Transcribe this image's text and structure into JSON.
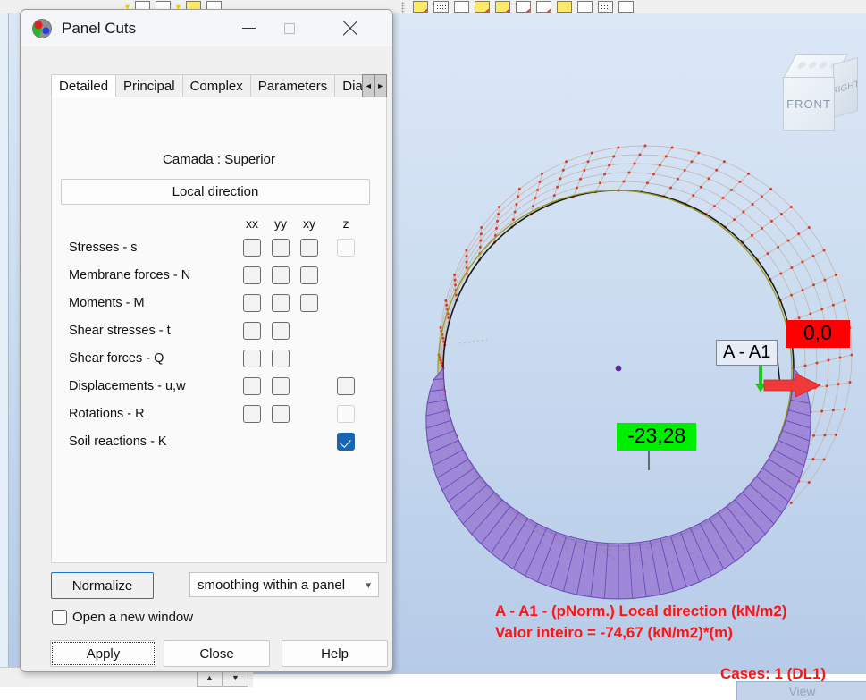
{
  "dialog": {
    "title": "Panel Cuts",
    "window_buttons": {
      "minimize": "minimize-icon",
      "maximize": "maximize-icon",
      "close": "close-icon"
    },
    "tabs": [
      {
        "label": "Detailed",
        "active": true
      },
      {
        "label": "Principal",
        "active": false
      },
      {
        "label": "Complex",
        "active": false
      },
      {
        "label": "Parameters",
        "active": false
      },
      {
        "label": "Dia",
        "active": false
      }
    ],
    "tab_nav": {
      "prev": "◄",
      "next": "►"
    },
    "layer_label": "Camada : Superior",
    "direction_button": "Local direction",
    "grid": {
      "columns": [
        "xx",
        "yy",
        "xy",
        "z"
      ],
      "rows": [
        {
          "label": "Stresses - s",
          "xx": "unchecked",
          "yy": "unchecked",
          "xy": "unchecked",
          "z": "disabled"
        },
        {
          "label": "Membrane forces - N",
          "xx": "unchecked",
          "yy": "unchecked",
          "xy": "unchecked",
          "z": "none"
        },
        {
          "label": "Moments - M",
          "xx": "unchecked",
          "yy": "unchecked",
          "xy": "unchecked",
          "z": "none"
        },
        {
          "label": "Shear stresses - t",
          "xx": "unchecked",
          "yy": "unchecked",
          "xy": "none",
          "z": "none"
        },
        {
          "label": "Shear forces - Q",
          "xx": "unchecked",
          "yy": "unchecked",
          "xy": "none",
          "z": "none"
        },
        {
          "label": "Displacements - u,w",
          "xx": "unchecked",
          "yy": "unchecked",
          "xy": "none",
          "z": "unchecked"
        },
        {
          "label": "Rotations - R",
          "xx": "unchecked",
          "yy": "unchecked",
          "xy": "none",
          "z": "disabled"
        },
        {
          "label": "Soil reactions - K",
          "xx": "none",
          "yy": "none",
          "xy": "none",
          "z": "checked"
        }
      ]
    },
    "normalize_button": "Normalize",
    "smoothing_select": {
      "value": "smoothing within a panel",
      "chevron": "chevron-down-icon"
    },
    "open_new_window": {
      "label": "Open a new window",
      "checked": false
    },
    "buttons": {
      "apply": "Apply",
      "close": "Close",
      "help": "Help"
    }
  },
  "viewport": {
    "cube": {
      "front": "FRONT",
      "right": "RIGHT"
    },
    "labels": {
      "section": "A - A1",
      "value_max": "0,0",
      "value_min": "-23,28"
    },
    "legend_line1": "A - A1 - (pNorm.) Local direction (kN/m2)",
    "legend_line2": "Valor inteiro = -74,67 (kN/m2)*(m)",
    "cases": "Cases: 1 (DL1)",
    "view_tab": "View",
    "colors": {
      "label_max_bg": "#fe0000",
      "label_min_bg": "#00ee00",
      "diagram_fill": "#9b82d6",
      "legend_text": "#ff1414",
      "background": "#cbdcf0"
    }
  },
  "bottom_bar": {
    "up_arrow": "▲",
    "down_arrow": "▼"
  }
}
